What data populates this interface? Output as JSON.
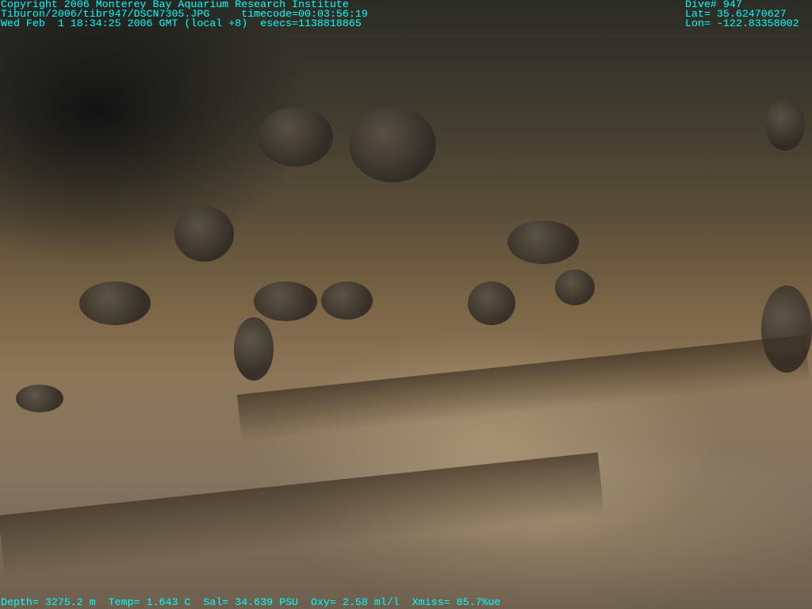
{
  "header_left": {
    "line1": "Copyright 2006 Monterey Bay Aquarium Research Institute",
    "line2": "Tiburon/2006/tibr947/DSCN7305.JPG     timecode=00:03:56:19",
    "line3": "Wed Feb  1 18:34:25 2006 GMT (local +8)  esecs=1138818865"
  },
  "header_right": {
    "line1": "Dive# 947",
    "line2": "Lat= 35.62470627",
    "line3": "Lon= -122.83358002"
  },
  "footer": {
    "line": "Depth= 3275.2 m  Temp= 1.643 C  Sal= 34.639 PSU  Oxy= 2.58 ml/l  Xmiss= 85.7%ue"
  },
  "colors": {
    "overlay_text": "#00ffff"
  }
}
